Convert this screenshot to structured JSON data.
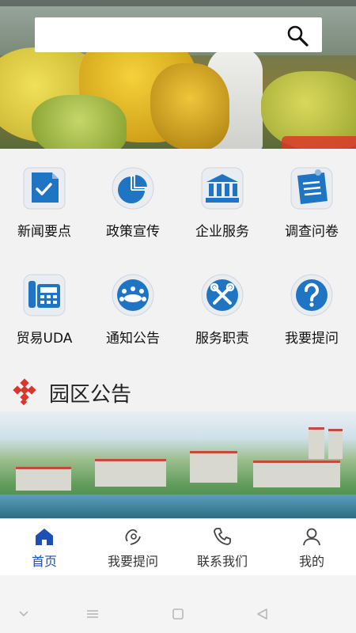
{
  "search": {
    "placeholder": "",
    "value": ""
  },
  "grid": {
    "items": [
      {
        "label": "新闻要点",
        "icon": "news-check-icon"
      },
      {
        "label": "政策宣传",
        "icon": "pie-chart-icon"
      },
      {
        "label": "企业服务",
        "icon": "bank-building-icon"
      },
      {
        "label": "调查问卷",
        "icon": "clipboard-list-icon"
      },
      {
        "label": "贸易UDA",
        "icon": "fax-phone-icon"
      },
      {
        "label": "通知公告",
        "icon": "meeting-table-icon"
      },
      {
        "label": "服务职责",
        "icon": "tools-icon"
      },
      {
        "label": "我要提问",
        "icon": "question-icon"
      }
    ]
  },
  "section": {
    "title": "园区公告",
    "icon": "diamond-cluster-icon"
  },
  "bottom_nav": {
    "items": [
      {
        "label": "首页",
        "icon": "home-icon",
        "active": true
      },
      {
        "label": "我要提问",
        "icon": "ask-icon",
        "active": false
      },
      {
        "label": "联系我们",
        "icon": "phone-icon",
        "active": false
      },
      {
        "label": "我的",
        "icon": "user-icon",
        "active": false
      }
    ]
  },
  "colors": {
    "accent": "#1e50b4",
    "icon_blue": "#1f74c4",
    "section_red": "#d9362c"
  }
}
